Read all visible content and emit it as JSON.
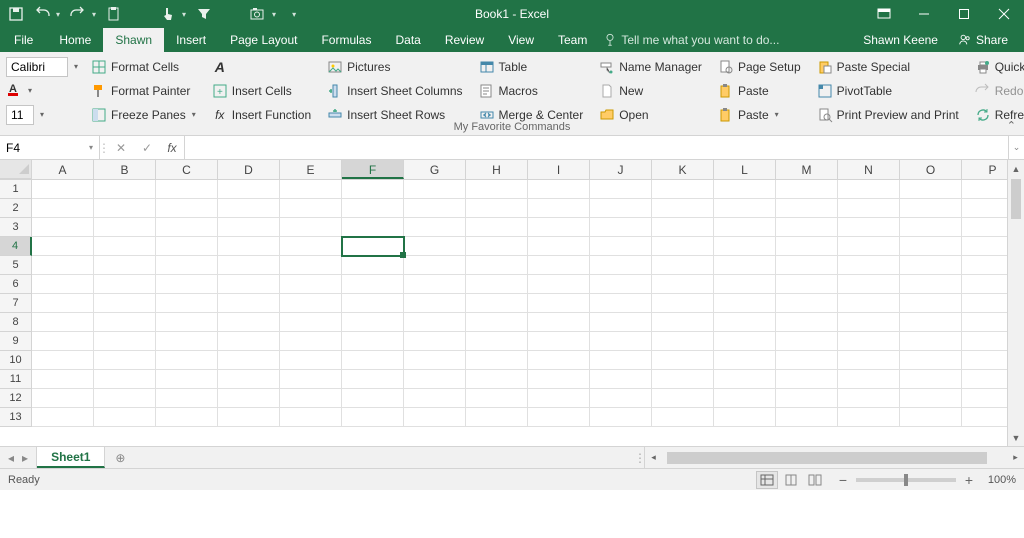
{
  "title": "Book1 - Excel",
  "user": "Shawn Keene",
  "share_label": "Share",
  "tabs": [
    "File",
    "Home",
    "Shawn",
    "Insert",
    "Page Layout",
    "Formulas",
    "Data",
    "Review",
    "View",
    "Team"
  ],
  "active_tab": "Shawn",
  "tellme_placeholder": "Tell me what you want to do...",
  "font": {
    "name": "Calibri",
    "size": "11"
  },
  "ribbon": {
    "col1": [
      "Format Cells",
      "Format Painter",
      "Freeze Panes"
    ],
    "col2_top_icon": "A",
    "col2": [
      "Insert Cells",
      "Insert Function"
    ],
    "col3": [
      "Pictures",
      "Insert Sheet Columns",
      "Insert Sheet Rows"
    ],
    "col4": [
      "Table",
      "Macros",
      "Merge & Center"
    ],
    "col5": [
      "Name Manager",
      "New",
      "Open"
    ],
    "col6": [
      "Page Setup",
      "Paste",
      "Paste"
    ],
    "col7": [
      "Paste Special",
      "PivotTable",
      "Print Preview and Print"
    ],
    "col8": [
      "Quick Print",
      "Redo",
      "Refresh All"
    ],
    "group_label": "My Favorite Commands"
  },
  "namebox": "F4",
  "formula": "",
  "columns": [
    "A",
    "B",
    "C",
    "D",
    "E",
    "F",
    "G",
    "H",
    "I",
    "J",
    "K",
    "L",
    "M",
    "N",
    "O",
    "P"
  ],
  "rows": [
    "1",
    "2",
    "3",
    "4",
    "5",
    "6",
    "7",
    "8",
    "9",
    "10",
    "11",
    "12",
    "13"
  ],
  "selected": {
    "col": "F",
    "row": "4"
  },
  "sheet": {
    "name": "Sheet1"
  },
  "status": {
    "label": "Ready",
    "zoom": "100%"
  }
}
